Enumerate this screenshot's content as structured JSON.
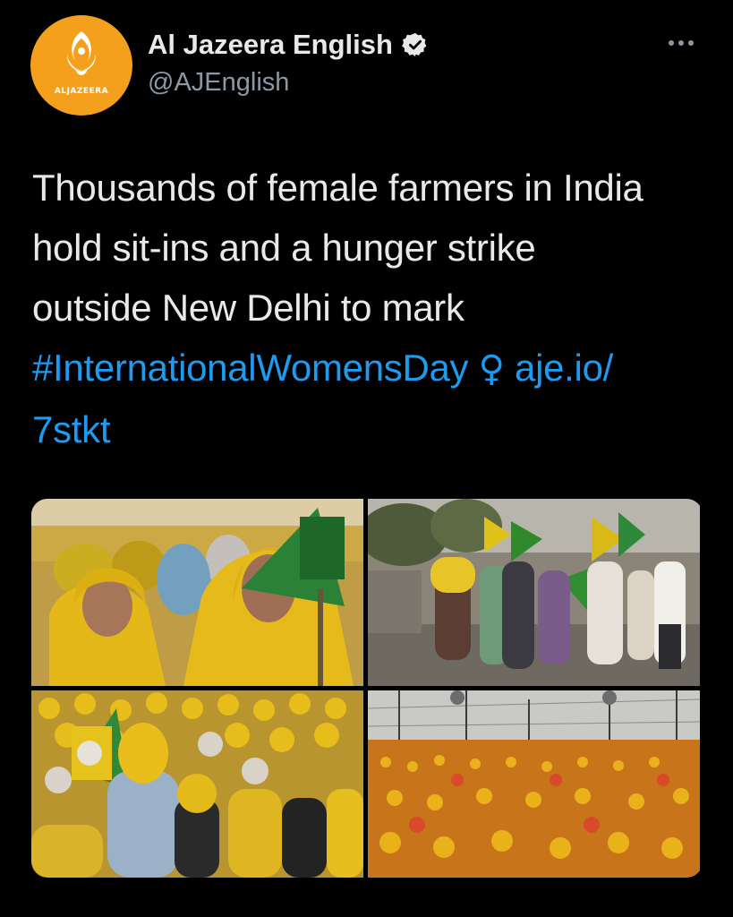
{
  "account": {
    "logo_text": "ALJAZEERA",
    "name": "Al Jazeera English",
    "handle": "@AJEnglish",
    "avatar_color": "#f4a01c",
    "verified_icon": "verified-badge-icon",
    "more_icon": "more-options-icon"
  },
  "tweet": {
    "line1": "Thousands of female farmers in India",
    "line2": "hold sit-ins and a hunger strike",
    "line3": "outside New Delhi to mark",
    "hashtag": "#InternationalWomensDay",
    "emoji": "♀",
    "link_part1": "aje.io/",
    "link_part2": "7stkt",
    "link_color": "#1d9bf0"
  },
  "media": {
    "photos": [
      {
        "name": "photo-women-in-yellow-scarves"
      },
      {
        "name": "photo-women-marching-with-flags"
      },
      {
        "name": "photo-seated-crowd-with-flag"
      },
      {
        "name": "photo-crowd-under-tent"
      }
    ]
  }
}
